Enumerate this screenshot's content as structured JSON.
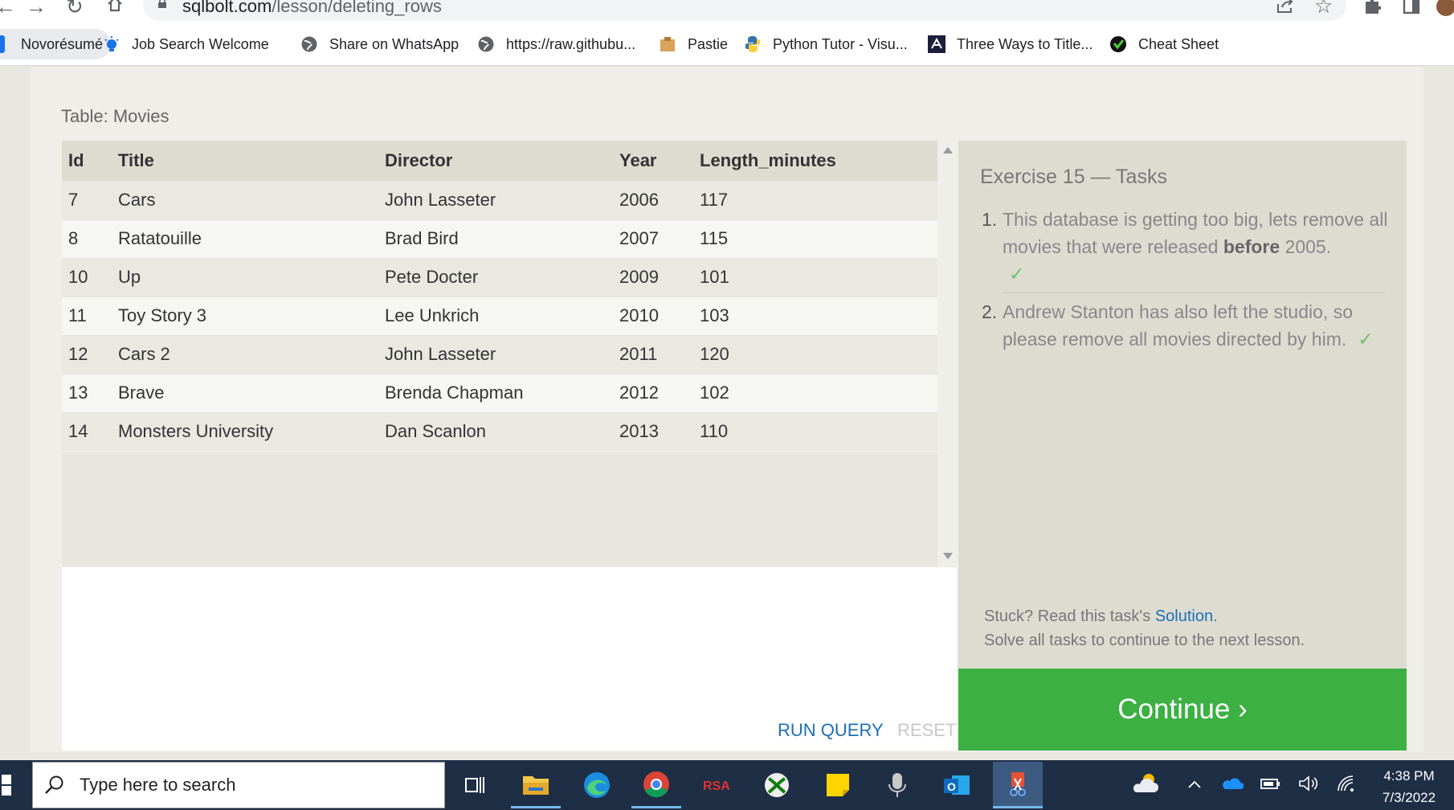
{
  "browser": {
    "url_host": "sqlbolt.com",
    "url_path": "/lesson/deleting_rows",
    "bookmarks": [
      {
        "label": "Novorésumé"
      },
      {
        "label": "Job Search Welcome"
      },
      {
        "label": "Share on WhatsApp"
      },
      {
        "label": "https://raw.githubu..."
      },
      {
        "label": "Pastie"
      },
      {
        "label": "Python Tutor - Visu..."
      },
      {
        "label": "Three Ways to Title..."
      },
      {
        "label": "Cheat Sheet"
      }
    ]
  },
  "table": {
    "caption": "Table: Movies",
    "columns": [
      "Id",
      "Title",
      "Director",
      "Year",
      "Length_minutes"
    ],
    "rows": [
      [
        "7",
        "Cars",
        "John Lasseter",
        "2006",
        "117"
      ],
      [
        "8",
        "Ratatouille",
        "Brad Bird",
        "2007",
        "115"
      ],
      [
        "10",
        "Up",
        "Pete Docter",
        "2009",
        "101"
      ],
      [
        "11",
        "Toy Story 3",
        "Lee Unkrich",
        "2010",
        "103"
      ],
      [
        "12",
        "Cars 2",
        "John Lasseter",
        "2011",
        "120"
      ],
      [
        "13",
        "Brave",
        "Brenda Chapman",
        "2012",
        "102"
      ],
      [
        "14",
        "Monsters University",
        "Dan Scanlon",
        "2013",
        "110"
      ]
    ]
  },
  "editor": {
    "run_label": "RUN QUERY",
    "reset_label": "RESET"
  },
  "tasks": {
    "title": "Exercise 15 — Tasks",
    "items": [
      {
        "num": "1.",
        "pre": "This database is getting too big, lets remove all movies that were released ",
        "bold": "before",
        "post": " 2005.",
        "check": "✓"
      },
      {
        "num": "2.",
        "pre": "Andrew Stanton has also left the studio, so please remove all movies directed by him.",
        "bold": "",
        "post": "",
        "check": "✓"
      }
    ],
    "stuck_prefix": "Stuck? Read this task's ",
    "solution_label": "Solution",
    "stuck_suffix": ".",
    "solve_all": "Solve all tasks to continue to the next lesson.",
    "continue_label": "Continue ›"
  },
  "taskbar": {
    "search_placeholder": "Type here to search",
    "time": "4:38 PM",
    "date": "7/3/2022"
  },
  "colors": {
    "continue_green": "#3cb043",
    "link_blue": "#1e6fb5",
    "check_green": "#6cc06c"
  }
}
